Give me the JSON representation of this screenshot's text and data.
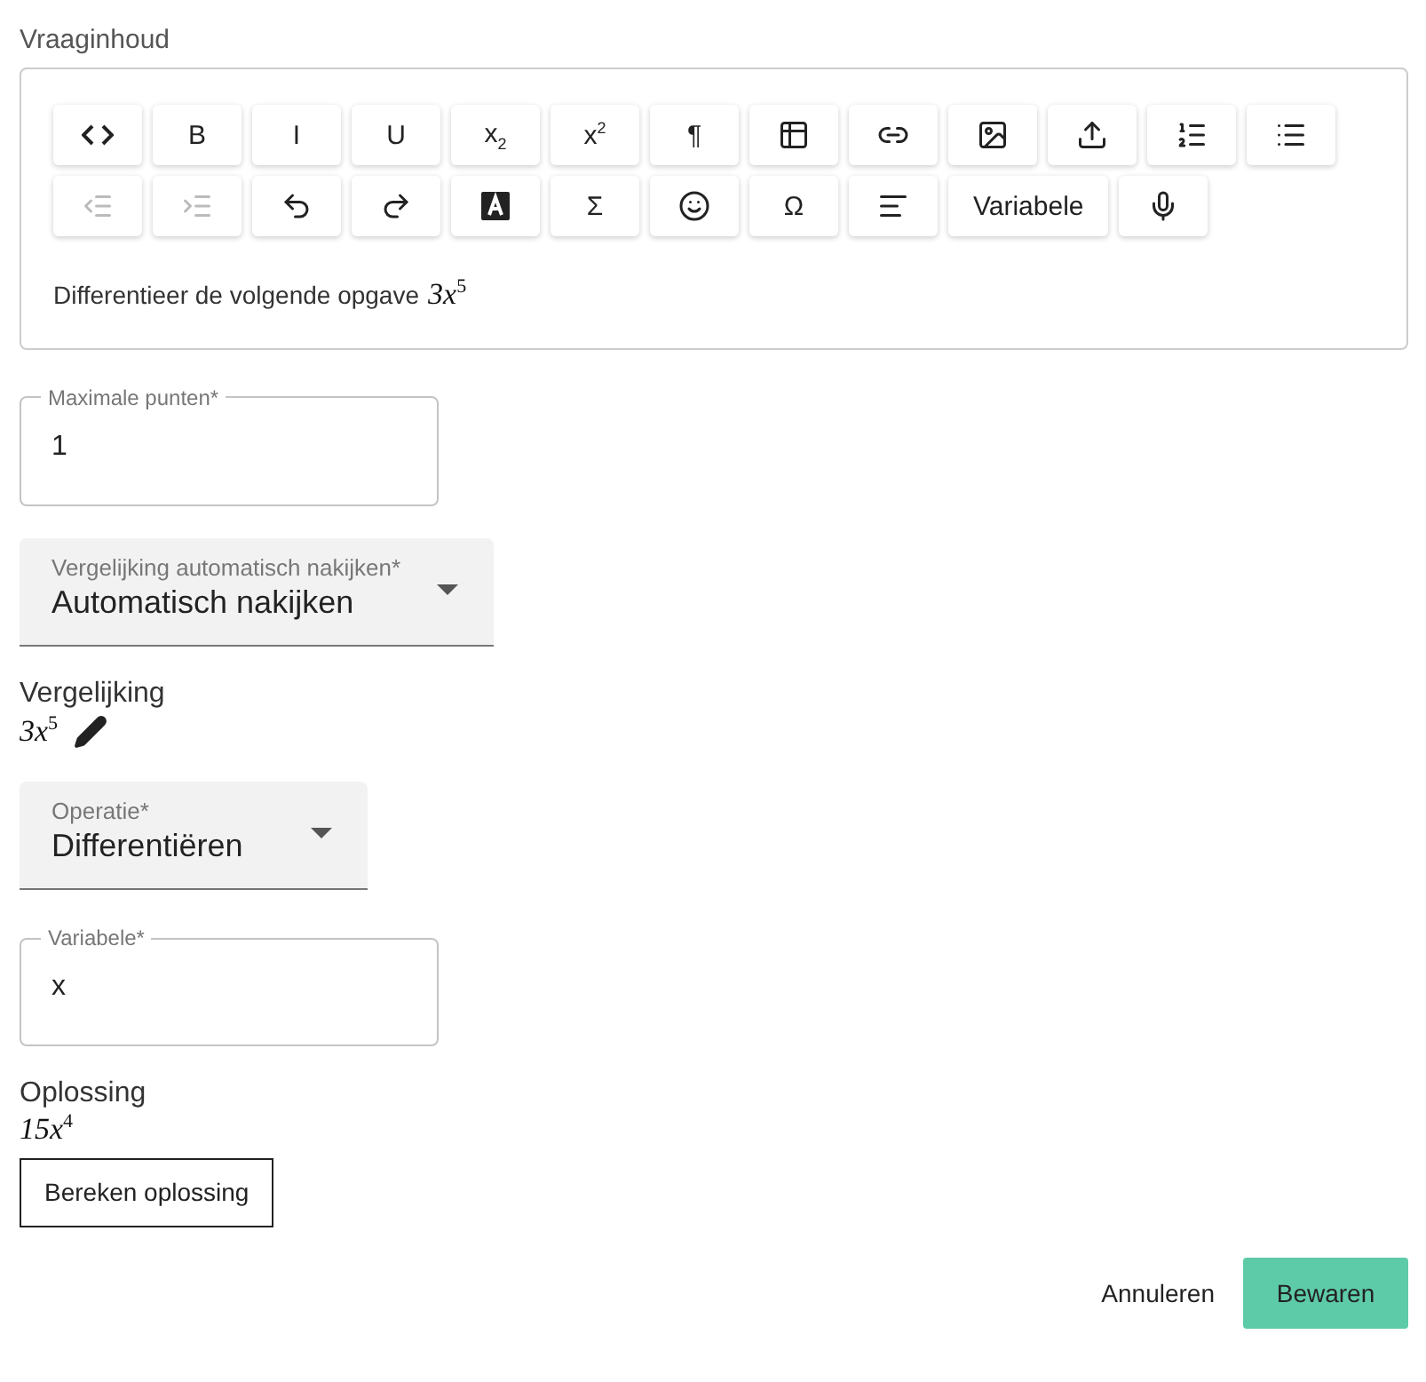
{
  "editor": {
    "label": "Vraaginhoud",
    "toolbar": [
      {
        "kind": "icon",
        "disabled": false
      },
      {
        "kind": "text",
        "label": "B",
        "disabled": false
      },
      {
        "kind": "text",
        "label": "I",
        "disabled": false
      },
      {
        "kind": "text",
        "label": "U",
        "disabled": false
      },
      {
        "kind": "text",
        "label": "x$_{2}$",
        "disabled": false
      },
      {
        "kind": "text",
        "label": "x$^{2}$",
        "disabled": false
      },
      {
        "kind": "text",
        "label": "¶",
        "disabled": false
      },
      {
        "kind": "icon",
        "disabled": false
      },
      {
        "kind": "icon",
        "disabled": false
      },
      {
        "kind": "icon",
        "disabled": false
      },
      {
        "kind": "icon",
        "disabled": false
      },
      {
        "kind": "icon",
        "disabled": false
      },
      {
        "kind": "icon",
        "disabled": false
      },
      {
        "kind": "icon",
        "disabled": true
      },
      {
        "kind": "icon",
        "disabled": true
      },
      {
        "kind": "icon",
        "disabled": false
      },
      {
        "kind": "icon",
        "disabled": false
      },
      {
        "kind": "icon",
        "disabled": false
      },
      {
        "kind": "text",
        "label": "Σ",
        "disabled": false
      },
      {
        "kind": "icon",
        "disabled": false
      },
      {
        "kind": "text",
        "label": "Ω",
        "disabled": false
      },
      {
        "kind": "icon",
        "disabled": false
      },
      {
        "kind": "text",
        "label": "Variabele",
        "disabled": false
      },
      {
        "kind": "icon",
        "disabled": false
      }
    ],
    "content": "Differentieer de volgende opgave",
    "formula": "3x$^{5}$"
  },
  "max_points": {
    "label": "Maximale punten*",
    "value": "1"
  },
  "grading": {
    "label": "Vergelijking automatisch nakijken*",
    "value": "Automatisch nakijken"
  },
  "equation": {
    "label": "Vergelijking",
    "formula": "3x$^{5}$"
  },
  "operation": {
    "label": "Operatie*",
    "value": "Differentiëren"
  },
  "variable": {
    "label": "Variabele*",
    "value": "x"
  },
  "solution": {
    "label": "Oplossing",
    "formula": "15x$^{4}$",
    "button": "Bereken oplossing"
  },
  "actions": {
    "cancel": "Annuleren",
    "save": "Bewaren"
  }
}
